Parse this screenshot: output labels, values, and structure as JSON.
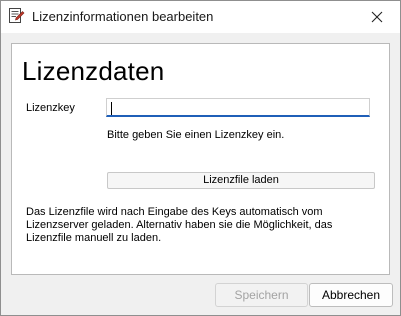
{
  "window": {
    "title": "Lizenzinformationen bearbeiten",
    "icon": "license-document-icon",
    "close_icon": "close-icon"
  },
  "form": {
    "heading": "Lizenzdaten",
    "key_label": "Lizenzkey",
    "key_value": "",
    "key_placeholder": "",
    "hint": "Bitte geben Sie einen Lizenzkey ein.",
    "load_button": "Lizenzfile laden",
    "info_text": "Das Lizenzfile wird nach Eingabe des Keys automatisch vom Lizenzserver geladen. Alternativ haben sie die Möglichkeit, das Lizenzfile manuell zu laden."
  },
  "footer": {
    "save_label": "Speichern",
    "save_enabled": false,
    "cancel_label": "Abbrechen"
  },
  "colors": {
    "input_focus_border": "#1f5fb8",
    "icon_accent": "#c0392b"
  }
}
